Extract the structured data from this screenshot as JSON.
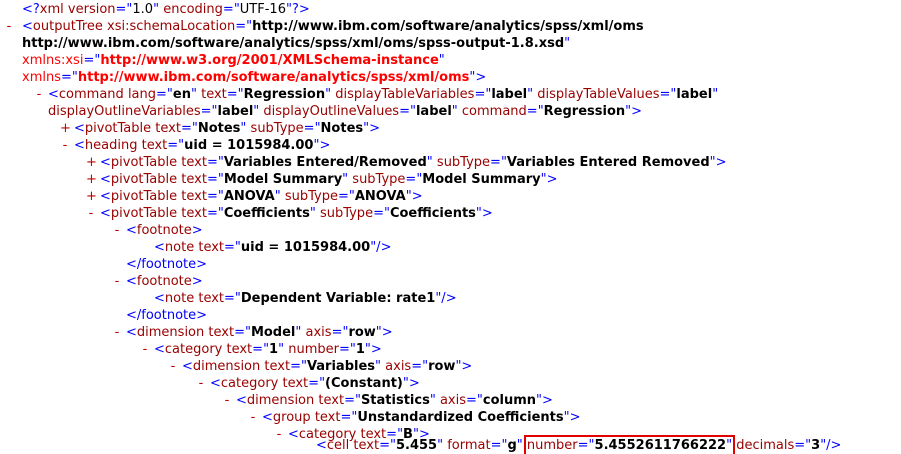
{
  "toggles": {
    "expanded": "-",
    "collapsed": "+"
  },
  "prolog": {
    "open": "<?",
    "target": "xml",
    "version_attr": "version",
    "version_val": "1.0",
    "encoding_attr": "encoding",
    "encoding_val": "UTF-16",
    "close": "?>"
  },
  "xml": {
    "outputTree": {
      "tag": "outputTree",
      "schemaLocation_attr": "xsi:schemaLocation",
      "schemaLocation_val1": "http://www.ibm.com/software/analytics/spss/xml/oms",
      "schemaLocation_val2": "http://www.ibm.com/software/analytics/spss/xml/oms/spss-output-1.8.xsd",
      "xmlns_xsi_attr": "xmlns:xsi",
      "xmlns_xsi_val": "http://www.w3.org/2001/XMLSchema-instance",
      "xmlns_attr": "xmlns",
      "xmlns_val": "http://www.ibm.com/software/analytics/spss/xml/oms"
    },
    "command": {
      "tag": "command",
      "lang_attr": "lang",
      "lang_val": "en",
      "text_attr": "text",
      "text_val": "Regression",
      "dtv_attr": "displayTableVariables",
      "dtv_val": "label",
      "dtval_attr": "displayTableValues",
      "dtval_val": "label",
      "dov_attr": "displayOutlineVariables",
      "dov_val": "label",
      "doval_attr": "displayOutlineValues",
      "doval_val": "label",
      "command_attr": "command",
      "command_val": "Regression"
    },
    "pivot_notes": {
      "tag": "pivotTable",
      "text_attr": "text",
      "text_val": "Notes",
      "subType_attr": "subType",
      "subType_val": "Notes"
    },
    "heading": {
      "tag": "heading",
      "text_attr": "text",
      "text_val": "uid = 1015984.00"
    },
    "pivot_vars": {
      "tag": "pivotTable",
      "text_attr": "text",
      "text_val": "Variables Entered/Removed",
      "subType_attr": "subType",
      "subType_val": "Variables Entered Removed"
    },
    "pivot_model": {
      "tag": "pivotTable",
      "text_attr": "text",
      "text_val": "Model Summary",
      "subType_attr": "subType",
      "subType_val": "Model Summary"
    },
    "pivot_anova": {
      "tag": "pivotTable",
      "text_attr": "text",
      "text_val": "ANOVA",
      "subType_attr": "subType",
      "subType_val": "ANOVA"
    },
    "pivot_coef": {
      "tag": "pivotTable",
      "text_attr": "text",
      "text_val": "Coefficients",
      "subType_attr": "subType",
      "subType_val": "Coefficients"
    },
    "footnote_tag": "footnote",
    "footnote_close": "</footnote>",
    "note_tag": "note",
    "note1": {
      "text_attr": "text",
      "text_val": "uid = 1015984.00"
    },
    "note2": {
      "text_attr": "text",
      "text_val": "Dependent Variable: rate1"
    },
    "dim_model": {
      "tag": "dimension",
      "text_attr": "text",
      "text_val": "Model",
      "axis_attr": "axis",
      "axis_val": "row"
    },
    "cat_1": {
      "tag": "category",
      "text_attr": "text",
      "text_val": "1",
      "number_attr": "number",
      "number_val": "1"
    },
    "dim_vars": {
      "tag": "dimension",
      "text_attr": "text",
      "text_val": "Variables",
      "axis_attr": "axis",
      "axis_val": "row"
    },
    "cat_const": {
      "tag": "category",
      "text_attr": "text",
      "text_val": "(Constant)"
    },
    "dim_stats": {
      "tag": "dimension",
      "text_attr": "text",
      "text_val": "Statistics",
      "axis_attr": "axis",
      "axis_val": "column"
    },
    "group_unstd": {
      "tag": "group",
      "text_attr": "text",
      "text_val": "Unstandardized Coefficients"
    },
    "cat_b": {
      "tag": "category",
      "text_attr": "text",
      "text_val": "B"
    },
    "cell": {
      "tag": "cell",
      "text_attr": "text",
      "text_val": "5.455",
      "format_attr": "format",
      "format_val": "g",
      "number_attr": "number",
      "number_val": "5.4552611766222",
      "decimals_attr": "decimals",
      "decimals_val": "3"
    }
  }
}
